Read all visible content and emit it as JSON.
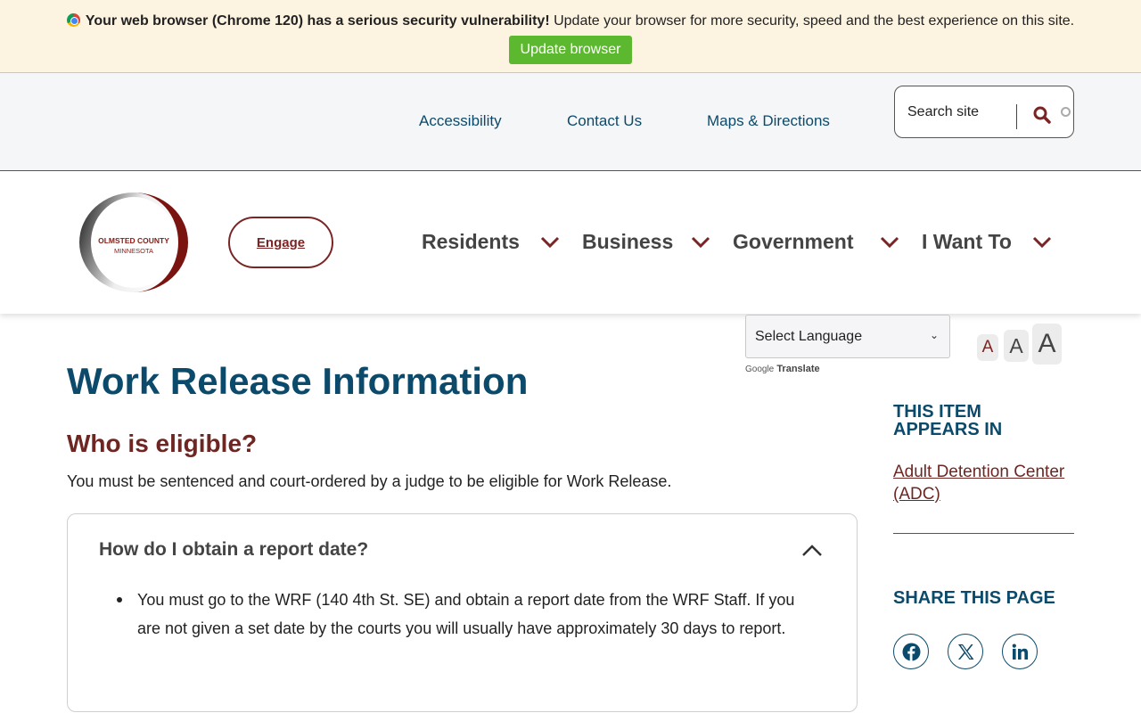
{
  "banner": {
    "bold": "Your web browser (Chrome 120) has a serious security vulnerability!",
    "rest": " Update your browser for more security, speed and the best experience on this site.",
    "button": "Update browser"
  },
  "utility": {
    "links": [
      "Accessibility",
      "Contact Us",
      "Maps & Directions"
    ],
    "search_placeholder": "Search site"
  },
  "header": {
    "logo_line1": "OLMSTED COUNTY",
    "logo_line2": "MINNESOTA",
    "engage": "Engage",
    "nav": [
      "Residents",
      "Business",
      "Government",
      "I Want To"
    ]
  },
  "tools": {
    "language": "Select Language",
    "powered_google": "Google",
    "powered_translate": "Translate",
    "font_sizes": [
      "A",
      "A",
      "A"
    ]
  },
  "content": {
    "title": "Work Release Information",
    "heading": "Who is eligible?",
    "intro": "You must be sentenced and court-ordered by a judge to be eligible for Work Release.",
    "accordion": {
      "title": "How do I obtain a report date?",
      "body": "You must go to the WRF (140 4th St. SE) and obtain a report date from the WRF Staff. If you are not given a set date by the courts you will usually have approximately 30 days to report."
    }
  },
  "sidebar": {
    "appears_heading": "THIS ITEM APPEARS IN",
    "appears_link": "Adult Detention Center (ADC)",
    "share_heading": "SHARE THIS PAGE",
    "social_icons": [
      "facebook-icon",
      "x-icon",
      "linkedin-icon"
    ]
  },
  "colors": {
    "navy": "#0b4a6a",
    "maroon": "#6e2622",
    "banner_bg": "#fdf3e1",
    "update_green": "#5cb82e"
  }
}
